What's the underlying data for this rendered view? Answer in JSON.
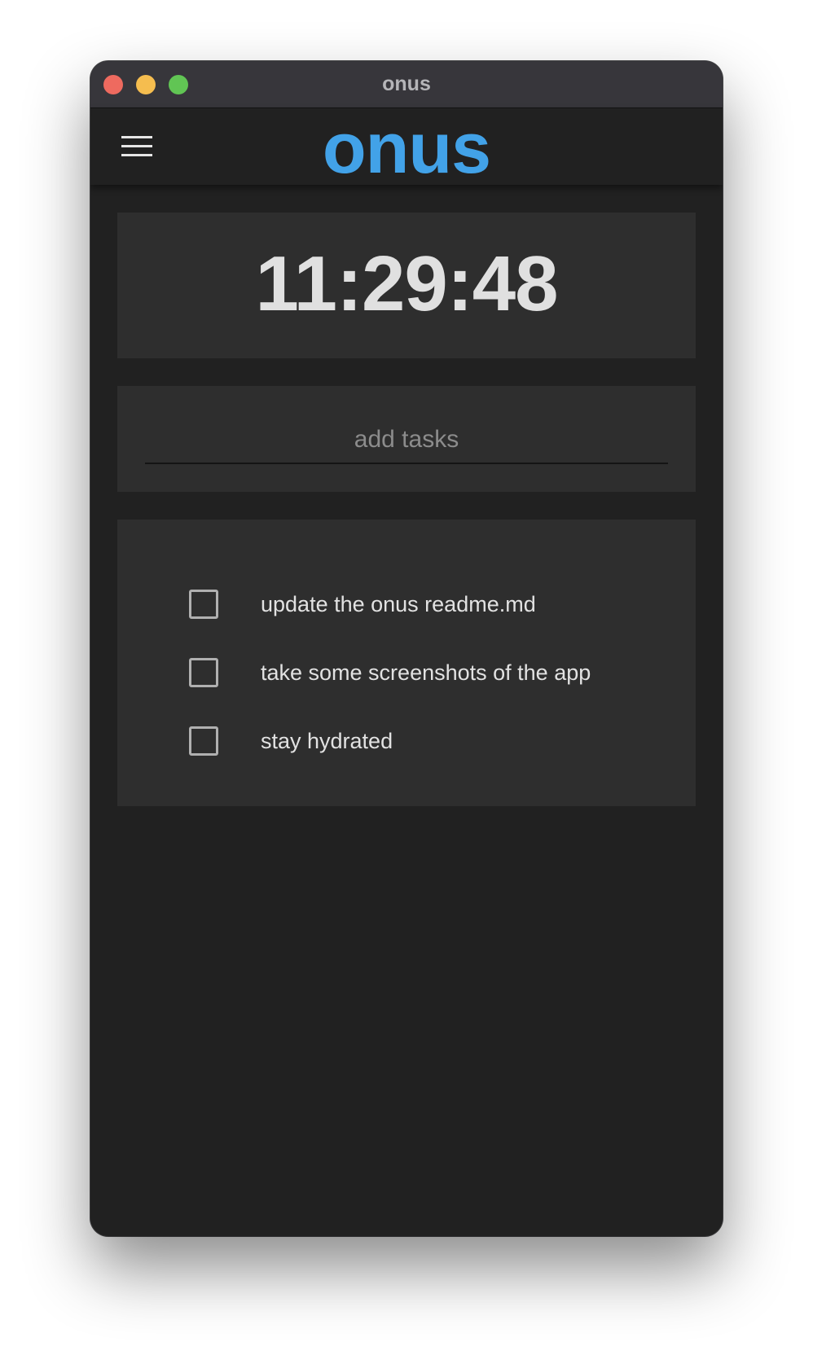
{
  "window": {
    "title": "onus"
  },
  "header": {
    "brand": "onus",
    "menu_icon": "hamburger-menu-icon"
  },
  "clock": {
    "time": "11:29:48"
  },
  "task_input": {
    "placeholder": "add tasks",
    "value": ""
  },
  "tasks": [
    {
      "label": "update the onus readme.md",
      "checked": false
    },
    {
      "label": "take some screenshots of the app",
      "checked": false
    },
    {
      "label": "stay hydrated",
      "checked": false
    }
  ],
  "colors": {
    "accent": "#42a2e8",
    "window_bg": "#212121",
    "card_bg": "#2e2e2e",
    "titlebar_bg": "#37363b",
    "text": "#e0e0e0",
    "traffic_close": "#ee6a5f",
    "traffic_minimize": "#f5bd4f",
    "traffic_maximize": "#61c554"
  }
}
